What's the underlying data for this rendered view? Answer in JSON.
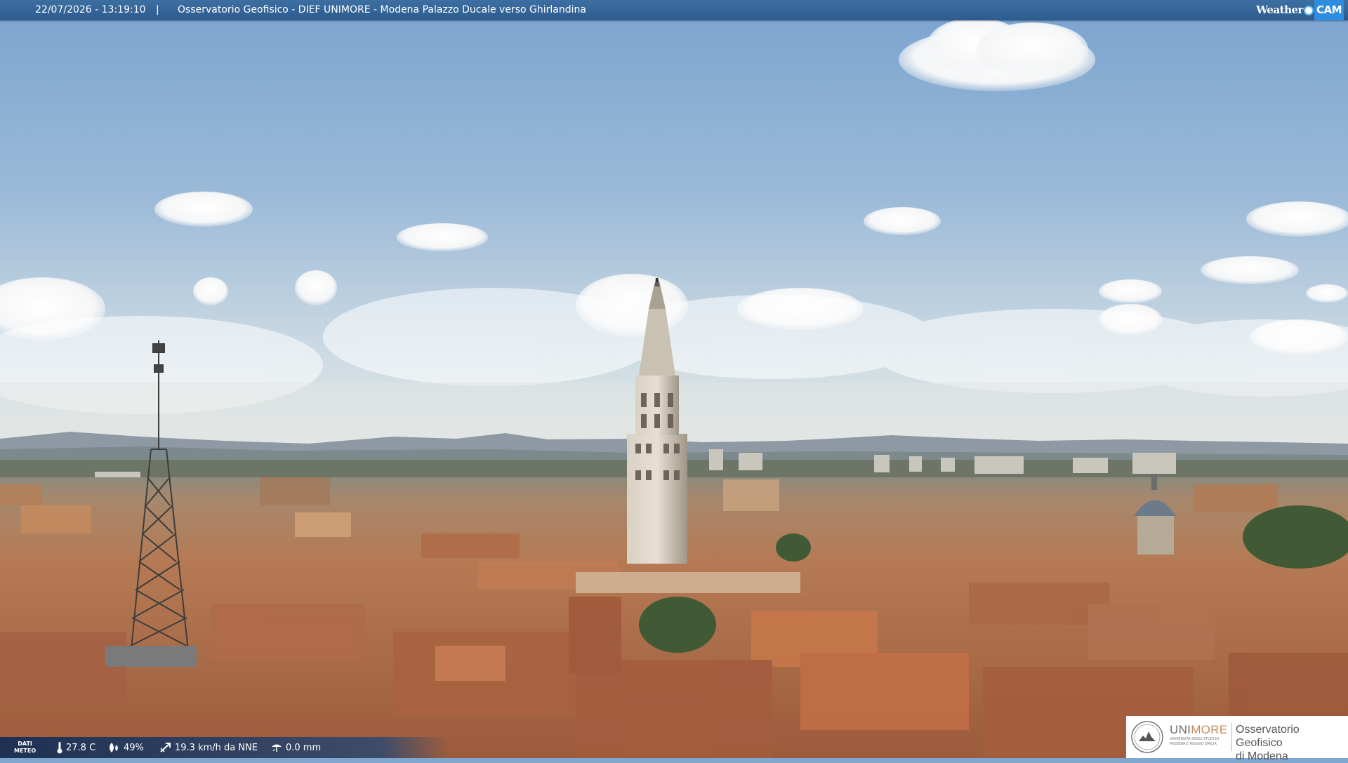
{
  "header": {
    "datetime": "22/07/2026 - 13:19:10",
    "separator": "|",
    "title": "Osservatorio Geofisico - DIEF UNIMORE - Modena Palazzo Ducale verso Ghirlandina",
    "logo_left": "Weather",
    "logo_right": "CAM"
  },
  "weather": {
    "label_line1": "DATI",
    "label_line2": "METEO",
    "temperature": "27.8 C",
    "humidity": "49%",
    "wind": "19.3 km/h da NNE",
    "rain": "0.0 mm",
    "icons": [
      "thermometer-icon",
      "humidity-icon",
      "wind-icon",
      "rain-icon"
    ]
  },
  "branding": {
    "uni_prefix": "UNI",
    "uni_suffix": "MORE",
    "uni_sub_line1": "UNIVERSITÀ DEGLI STUDI DI",
    "uni_sub_line2": "MODENA E REGGIO EMILIA",
    "observatory_line1": "Osservatorio Geofisico",
    "observatory_line2": "di Modena"
  },
  "colors": {
    "sky_top": "#7ea5cf",
    "sky_horizon": "#dfe6ea",
    "roof": "#b8704a",
    "header_bar": "#33649a",
    "unimore_accent": "#c98b5a"
  }
}
